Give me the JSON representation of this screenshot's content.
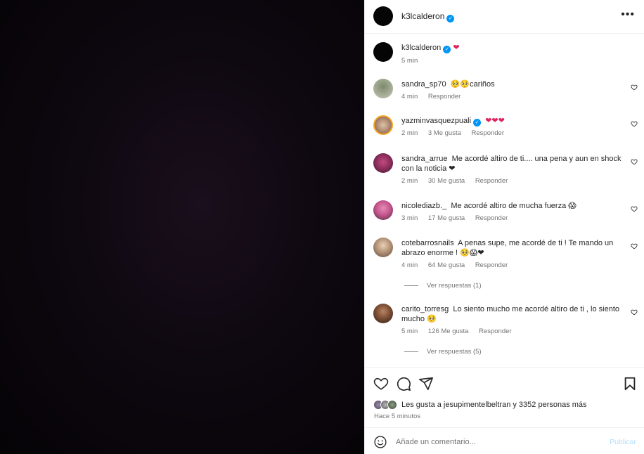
{
  "post": {
    "author": "k3lcalderon",
    "caption_heart": "❤",
    "caption_time": "5 min",
    "more_icon": "more-horizontal-icon"
  },
  "comments": [
    {
      "user": "sandra_sp70",
      "text": "🥺🥺cariños",
      "time": "4 min",
      "likes": "",
      "reply": "Responder"
    },
    {
      "user": "yazminvasquezpuali",
      "verified": true,
      "text": "❤❤❤",
      "time": "2 min",
      "likes": "3 Me gusta",
      "reply": "Responder"
    },
    {
      "user": "sandra_arrue",
      "text": "Me acordé altiro de ti.... una pena y aun en shock con la noticia ❤",
      "time": "2 min",
      "likes": "30 Me gusta",
      "reply": "Responder"
    },
    {
      "user": "nicolediazb._",
      "text": "Me acordé altiro de mucha fuerza 😱",
      "time": "3 min",
      "likes": "17 Me gusta",
      "reply": "Responder"
    },
    {
      "user": "cotebarrosnails",
      "text": "A penas supe, me acordé de ti ! Te mando un abrazo enorme ! 🥺😱❤",
      "time": "4 min",
      "likes": "64 Me gusta",
      "reply": "Responder",
      "replies": "Ver respuestas (1)"
    },
    {
      "user": "carito_torresg",
      "text": "Lo siento mucho me acordé altiro de ti , lo siento mucho 🥺",
      "time": "5 min",
      "likes": "126 Me gusta",
      "reply": "Responder",
      "replies": "Ver respuestas (5)"
    }
  ],
  "footer": {
    "likes_text": "Les gusta a jesupimentelbeltran y 3352 personas más",
    "time_ago": "Hace 5 minutos",
    "comment_placeholder": "Añade un comentario...",
    "post_label": "Publicar"
  },
  "colors": {
    "verified": "#0095f6",
    "heart": "#e0245e",
    "post_disabled": "#b2dffc"
  }
}
